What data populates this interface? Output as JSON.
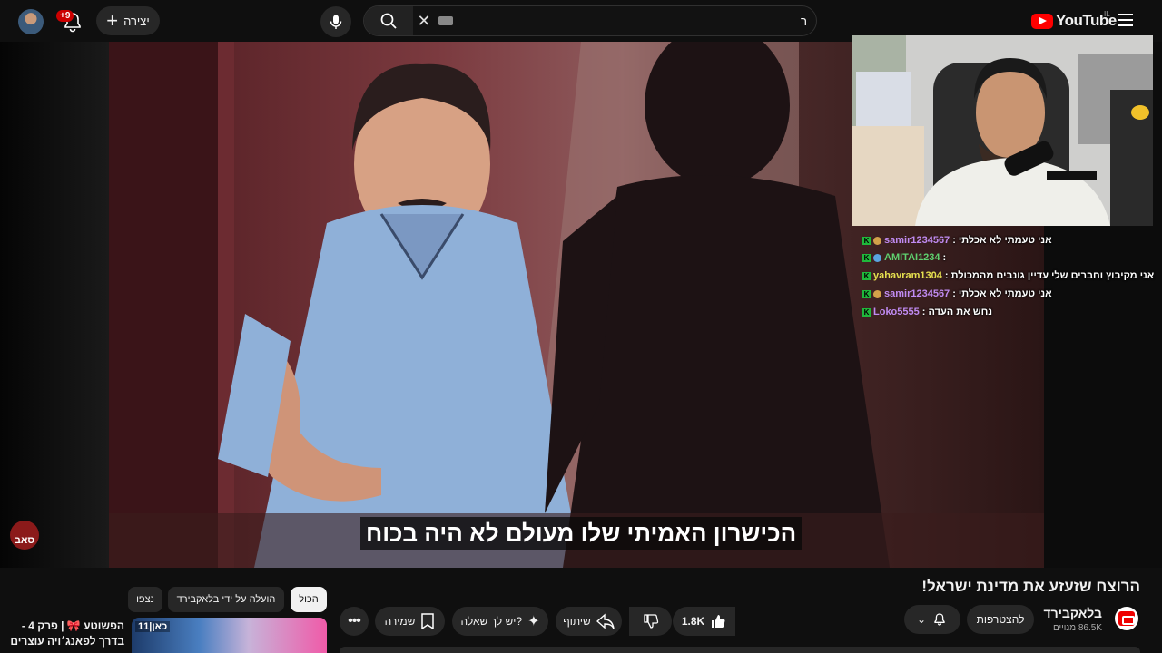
{
  "header": {
    "notifications_badge": "+9",
    "create_label": "יצירה",
    "search_value": "ר",
    "logo_text": "YouTube",
    "logo_region": "IL"
  },
  "video": {
    "subtitle": "הכישרון האמיתי שלו מעולם לא היה בכוח",
    "watermark_text": "סאב"
  },
  "chat": {
    "messages": [
      {
        "user": "samir1234567",
        "text": "אני טעמתי לא אכלתי :",
        "user_color": "#c08bf2"
      },
      {
        "user": "AMITAI1234",
        "text": ":",
        "user_color": "#5fd16f"
      },
      {
        "user": "yahavram1304",
        "text": "אני מקיבוץ וחברים שלי עדיין גונבים מהמכולת :",
        "user_color": "#e6e04f"
      },
      {
        "user": "samir1234567",
        "text": "אני טעמתי לא אכלתי :",
        "user_color": "#c08bf2"
      },
      {
        "user": "Loko5555",
        "text": "נחש את העדה :",
        "user_color": "#c08bf2"
      }
    ]
  },
  "watch": {
    "title": "הרוצח שזעזע את מדינת ישראל!",
    "channel_name": "בלאקבירד",
    "subscribers": "86.5K מנויים",
    "join_label": "להצטרפות",
    "like_count": "1.8K",
    "share_label": "שיתוף",
    "ask_label": "יש לך שאלה?",
    "save_label": "שמירה"
  },
  "related": {
    "chips": [
      "הכול",
      "הועלה על ידי בלאקבירד",
      "נצפו"
    ],
    "video": {
      "title_line1": "הפשוטע 🎀 | פרק 4 -",
      "title_line2": "בדרך לפאנג׳ויה עוצרים",
      "thumb_badge": "כאן|11"
    }
  },
  "colors": {
    "background": "#0f0f0f",
    "accent_red": "#ff0000",
    "chip_bg": "#272727",
    "chat_badge_green": "#1fb83b"
  }
}
